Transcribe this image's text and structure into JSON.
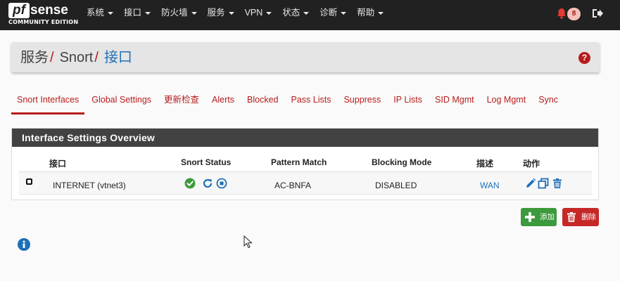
{
  "brand": {
    "logo_main": "pf",
    "logo_second": "sense",
    "edition": "COMMUNITY EDITION"
  },
  "nav": {
    "menu": [
      "系统",
      "接口",
      "防火墙",
      "服务",
      "VPN",
      "状态",
      "诊断",
      "帮助"
    ],
    "notification_count": "8"
  },
  "breadcrumb": {
    "level1": "服务",
    "level2": "Snort",
    "level3": "接口",
    "separator": "/"
  },
  "tabs": [
    "Snort Interfaces",
    "Global Settings",
    "更新检查",
    "Alerts",
    "Blocked",
    "Pass Lists",
    "Suppress",
    "IP Lists",
    "SID Mgmt",
    "Log Mgmt",
    "Sync"
  ],
  "active_tab": "Snort Interfaces",
  "panel": {
    "title": "Interface Settings Overview",
    "columns": [
      "接口",
      "Snort Status",
      "Pattern Match",
      "Blocking Mode",
      "描述",
      "动作"
    ],
    "rows": [
      {
        "interface": "INTERNET (vtnet3)",
        "pattern_match": "AC-BNFA",
        "blocking_mode": "DISABLED",
        "description": "WAN",
        "status": "running"
      }
    ]
  },
  "buttons": {
    "add": "添加",
    "delete": "删除"
  },
  "colors": {
    "navbar": "#212121",
    "accent": "#b71c1c",
    "link": "#1e6fb8",
    "success": "#3c9a3c",
    "danger": "#c62828"
  }
}
